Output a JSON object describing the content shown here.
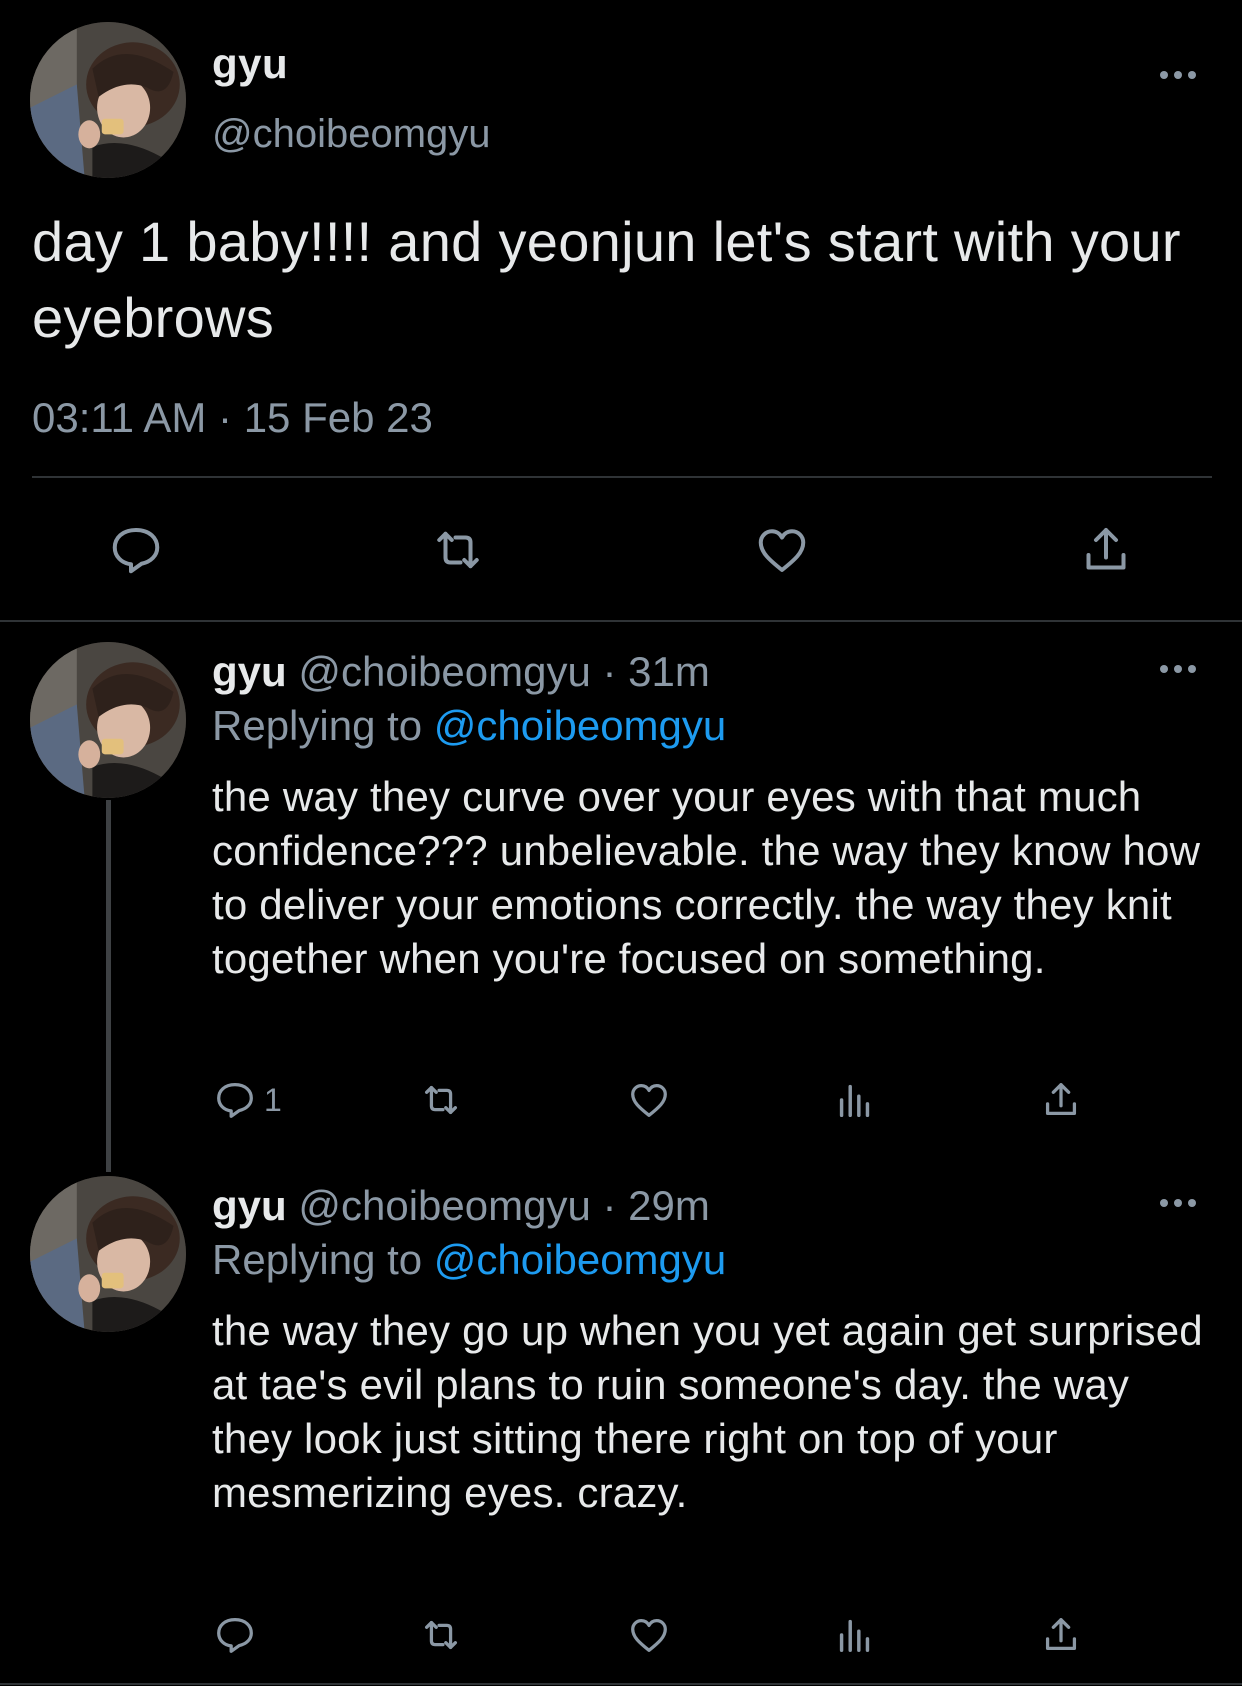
{
  "main_tweet": {
    "name": "gyu",
    "handle": "@choibeomgyu",
    "text": "day 1 baby!!!! and yeonjun let's start with your eyebrows",
    "time": "03:11 AM",
    "separator": "·",
    "date": "15 Feb 23",
    "actions": [
      "reply-icon",
      "retweet-icon",
      "like-icon",
      "share-icon"
    ]
  },
  "replies": [
    {
      "name": "gyu",
      "handle": "@choibeomgyu",
      "separator": "·",
      "age": "31m",
      "replying_prefix": "Replying to",
      "replying_to": "@choibeomgyu",
      "text": "the way they curve over your eyes with that much confidence??? unbelievable. the way they know how to deliver your emotions correctly. the way they knit together when you're focused on something.",
      "reply_count": "1"
    },
    {
      "name": "gyu",
      "handle": "@choibeomgyu",
      "separator": "·",
      "age": "29m",
      "replying_prefix": "Replying to",
      "replying_to": "@choibeomgyu",
      "text": "the way they go up when you yet again get surprised at tae's evil plans to ruin someone's day. the way they look just sitting there right on top of your mesmerizing eyes. crazy.",
      "reply_count": ""
    }
  ],
  "colors": {
    "background": "#000000",
    "text": "#e7e9ea",
    "secondary": "#8b98a5",
    "link": "#1d9bf0",
    "divider": "#2f3336"
  }
}
